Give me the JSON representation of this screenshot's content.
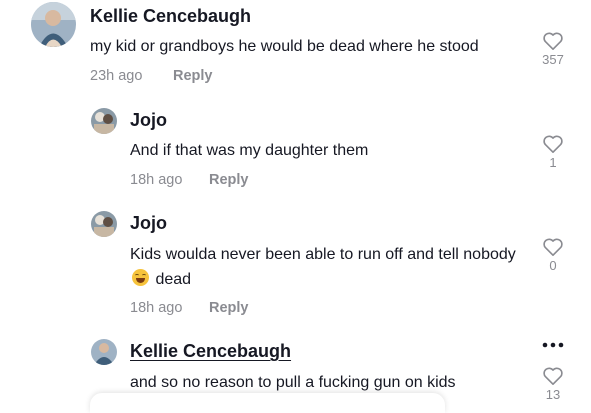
{
  "comments": [
    {
      "username": "Kellie Cencebaugh",
      "text": "my kid or grandboys he would be dead where he stood",
      "time": "23h ago",
      "reply_label": "Reply",
      "likes": "357"
    },
    {
      "username": "Jojo",
      "text": "And if that was my daughter them",
      "time": "18h ago",
      "reply_label": "Reply",
      "likes": "1"
    },
    {
      "username": "Jojo",
      "text_before_emoji": "Kids woulda never been able to run off and tell nobody",
      "emoji": "laughing-tears",
      "text_after_emoji": "dead",
      "time": "18h ago",
      "reply_label": "Reply",
      "likes": "0"
    },
    {
      "username": "Kellie Cencebaugh",
      "text": "and so no reason to pull a fucking gun on kids",
      "likes": "13"
    }
  ],
  "colors": {
    "text": "#161823",
    "meta": "#8a8b91"
  },
  "icons": {
    "like": "heart-outline-icon",
    "more": "more-horizontal-icon"
  }
}
